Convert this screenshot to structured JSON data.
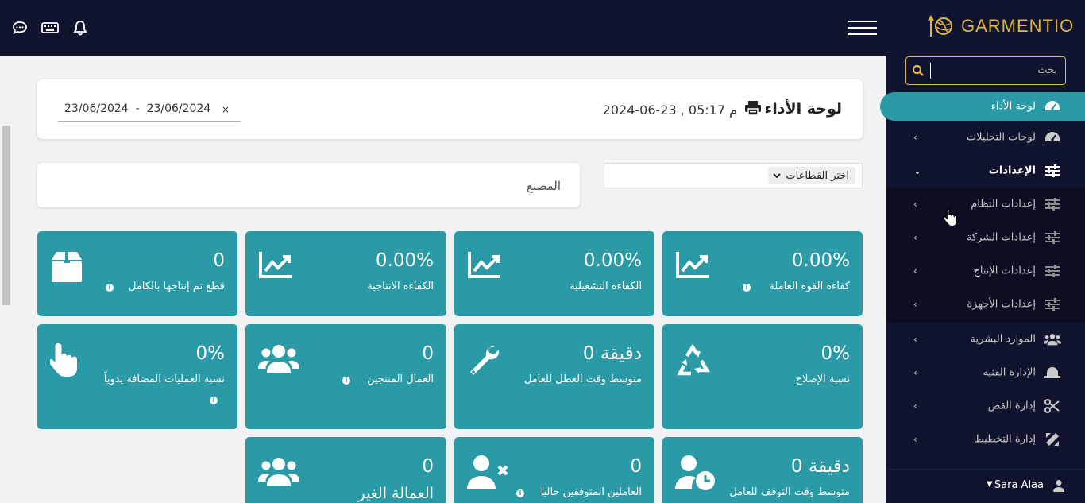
{
  "brand": {
    "name": "GARMENTIO"
  },
  "colors": {
    "navy": "#11142e",
    "teal": "#2a9aa6",
    "gold": "#e0b54a"
  },
  "topbar": {
    "icons": [
      "chat-icon",
      "keyboard-icon",
      "bell-icon"
    ],
    "menu_icon": "hamburger-icon"
  },
  "sidebar": {
    "search_placeholder": "بحث",
    "items": [
      {
        "label": "لوحة الأداء",
        "icon": "dashboard-gauge-icon"
      },
      {
        "label": "لوحات التحليلات",
        "icon": "analytics-gauge-icon"
      },
      {
        "label": "الإعدادات",
        "icon": "sliders-icon"
      },
      {
        "label": "إعدادات النظام",
        "icon": "sliders-icon"
      },
      {
        "label": "إعدادات الشركة",
        "icon": "sliders-icon"
      },
      {
        "label": "إعدادات الإنتاج",
        "icon": "sliders-icon"
      },
      {
        "label": "إعدادات الأجهزة",
        "icon": "sliders-icon"
      },
      {
        "label": "الموارد البشرية",
        "icon": "users-icon"
      },
      {
        "label": "الإدارة الفنيه",
        "icon": "hat-icon"
      },
      {
        "label": "إدارة القص",
        "icon": "scissors-icon"
      },
      {
        "label": "إدارة التخطيط",
        "icon": "ruler-pencil-icon"
      }
    ],
    "user": {
      "name": "Sara Alaa"
    }
  },
  "header": {
    "title": "لوحة الأداء",
    "datetime": "2024-06-23 , 05:17 م",
    "date_from": "23/06/2024",
    "date_to": "23/06/2024",
    "range_separator": "-"
  },
  "filters": {
    "factory_label": "المصنع",
    "sector_select": "اختر القطاعات"
  },
  "tiles": [
    {
      "value": "0.00%",
      "label": "كفاءة القوة العاملة",
      "icon": "chart-line-icon"
    },
    {
      "value": "0.00%",
      "label": "الكفاءة التشغيلية",
      "icon": "chart-line-icon"
    },
    {
      "value": "0.00%",
      "label": "الكفاءة الانتاجية",
      "icon": "chart-line-icon"
    },
    {
      "value": "0",
      "label": "قطع تم إنتاجها بالكامل",
      "icon": "box-icon"
    },
    {
      "value": "0%",
      "label": "نسبة الإصلاح",
      "icon": "recycle-icon"
    },
    {
      "value": "0 دقيقة",
      "label": "متوسط وقت العطل للعامل",
      "icon": "wrench-icon"
    },
    {
      "value": "0",
      "label": "العمال المنتجين",
      "icon": "users-icon"
    },
    {
      "value": "0%",
      "label": "نسبة العمليات المضافة يدوياً",
      "icon": "hand-pointer-icon"
    },
    {
      "value": "0 دقيقة",
      "label": "متوسط وقت التوقف للعامل",
      "icon": "user-clock-icon"
    },
    {
      "value": "0",
      "label": "العاملين المتوقفين حاليا",
      "icon": "user-times-icon"
    },
    {
      "value": "0",
      "label": "العمالة الغير",
      "icon": "users-icon"
    }
  ]
}
